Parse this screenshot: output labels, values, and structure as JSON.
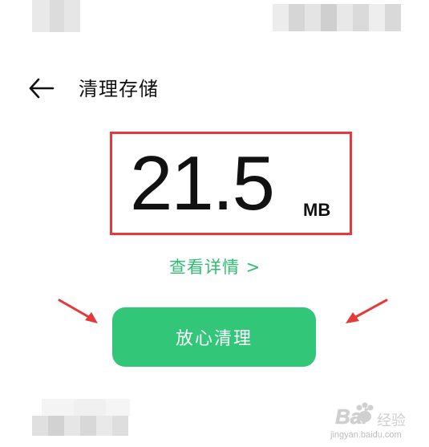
{
  "header": {
    "title": "清理存储",
    "back_icon": "arrow-left-icon"
  },
  "storage": {
    "value": "21.5",
    "unit": "MB"
  },
  "details_link": "查看详情 >",
  "clean_button_label": "放心清理",
  "watermark": {
    "brand": "Bai",
    "brand_tail": "经验",
    "url": "jingyan.baidu.com"
  },
  "colors": {
    "accent_green": "#32c678",
    "link_green": "#2fbd71",
    "highlight_red": "#e5393a",
    "arrow_red": "#e5393a"
  }
}
